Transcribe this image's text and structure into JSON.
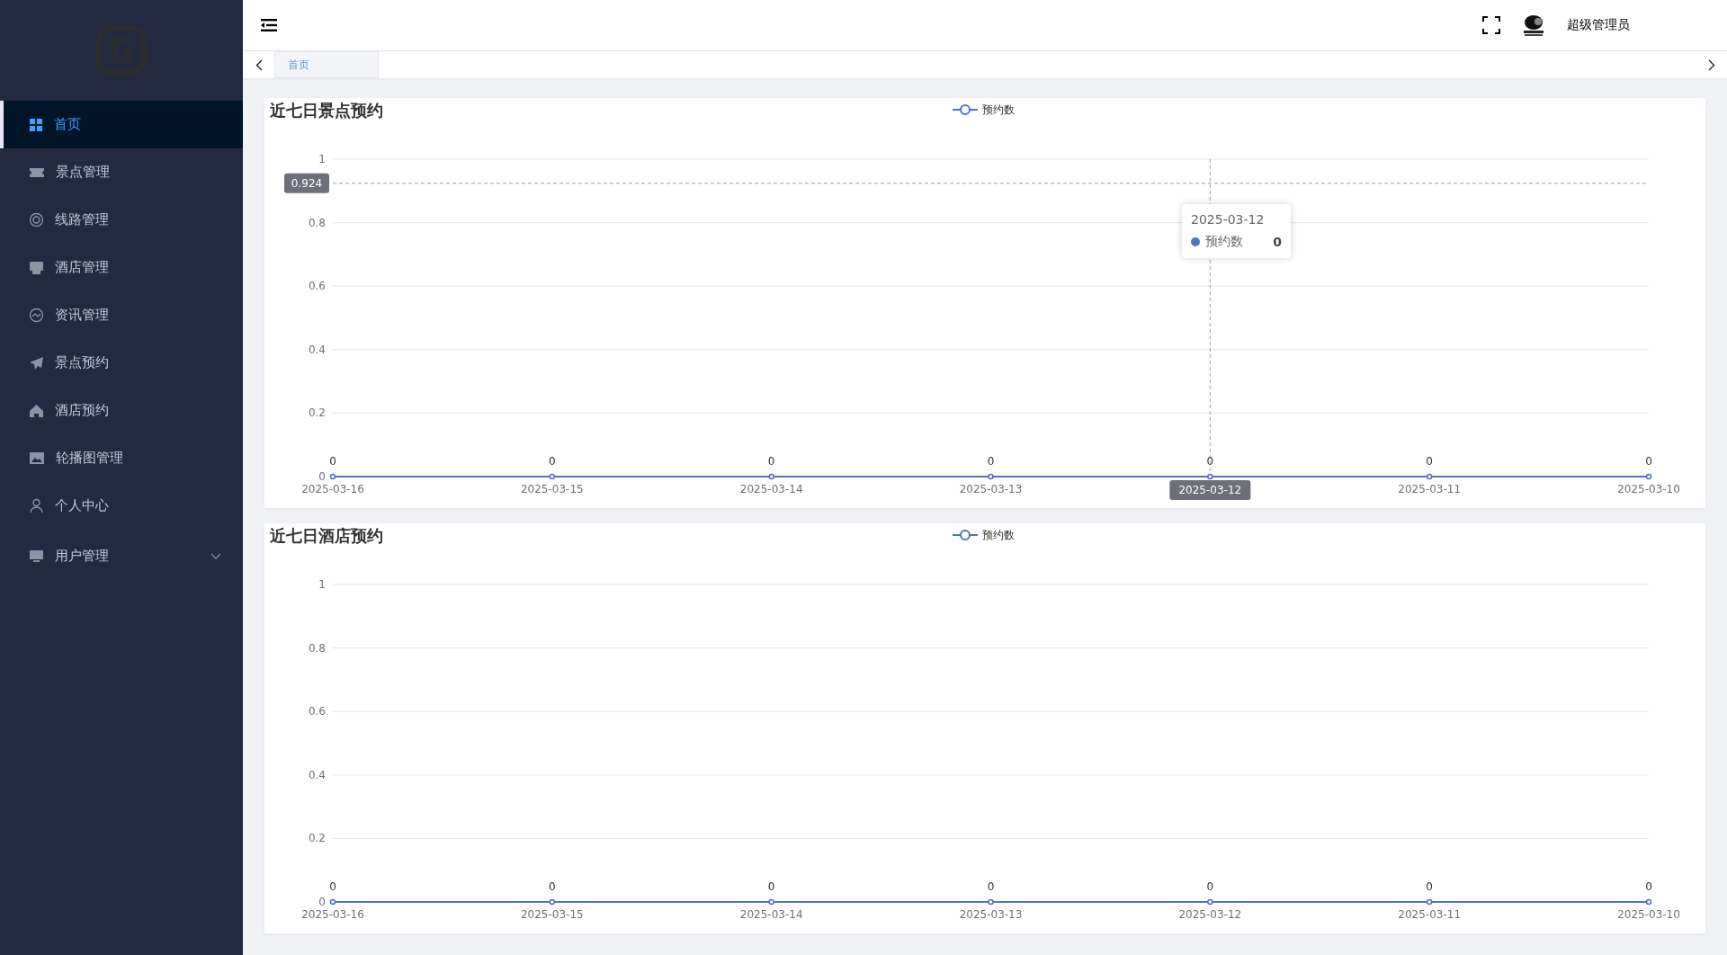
{
  "sidebar": {
    "items": [
      {
        "label": "首页",
        "selected": true,
        "kind": "link"
      },
      {
        "label": "景点管理",
        "selected": false,
        "kind": "link"
      },
      {
        "label": "线路管理",
        "selected": false,
        "kind": "link"
      },
      {
        "label": "酒店管理",
        "selected": false,
        "kind": "link"
      },
      {
        "label": "资讯管理",
        "selected": false,
        "kind": "link"
      },
      {
        "label": "景点预约",
        "selected": false,
        "kind": "link"
      },
      {
        "label": "酒店预约",
        "selected": false,
        "kind": "link"
      },
      {
        "label": "轮播图管理",
        "selected": false,
        "kind": "link"
      },
      {
        "label": "个人中心",
        "selected": false,
        "kind": "link"
      },
      {
        "label": "用户管理",
        "selected": false,
        "kind": "submenu"
      }
    ]
  },
  "header": {
    "user_name": "超级管理员"
  },
  "tabs": [
    {
      "label": "首页",
      "selected": true
    }
  ],
  "charts": [
    {
      "title": "近七日景点预约",
      "chart_data": {
        "type": "line",
        "categories": [
          "2025-03-16",
          "2025-03-15",
          "2025-03-14",
          "2025-03-13",
          "2025-03-12",
          "2025-03-11",
          "2025-03-10"
        ],
        "series": [
          {
            "name": "预约数",
            "color": "#5470c6",
            "values": [
              0,
              0,
              0,
              0,
              0,
              0,
              0
            ]
          }
        ],
        "ylim": [
          0,
          1
        ],
        "yticks": [
          0,
          0.2,
          0.4,
          0.6,
          0.8,
          1
        ],
        "data_labels": true,
        "grid": true,
        "marker": "circle",
        "ref_lines": [
          {
            "axis": "y",
            "value": 0.924,
            "label": "0.924"
          },
          {
            "axis": "x",
            "value": "2025-03-12",
            "label": "2025-03-12"
          }
        ]
      },
      "tooltip": {
        "title": "2025-03-12",
        "series_name": "预约数",
        "value": "0"
      }
    },
    {
      "title": "近七日酒店预约",
      "chart_data": {
        "type": "line",
        "categories": [
          "2025-03-16",
          "2025-03-15",
          "2025-03-14",
          "2025-03-13",
          "2025-03-12",
          "2025-03-11",
          "2025-03-10"
        ],
        "series": [
          {
            "name": "预约数",
            "color": "#5470c6",
            "values": [
              0,
              0,
              0,
              0,
              0,
              0,
              0
            ]
          }
        ],
        "ylim": [
          0,
          1
        ],
        "yticks": [
          0,
          0.2,
          0.4,
          0.6,
          0.8,
          1
        ],
        "data_labels": true,
        "grid": true,
        "marker": "circle"
      }
    }
  ]
}
